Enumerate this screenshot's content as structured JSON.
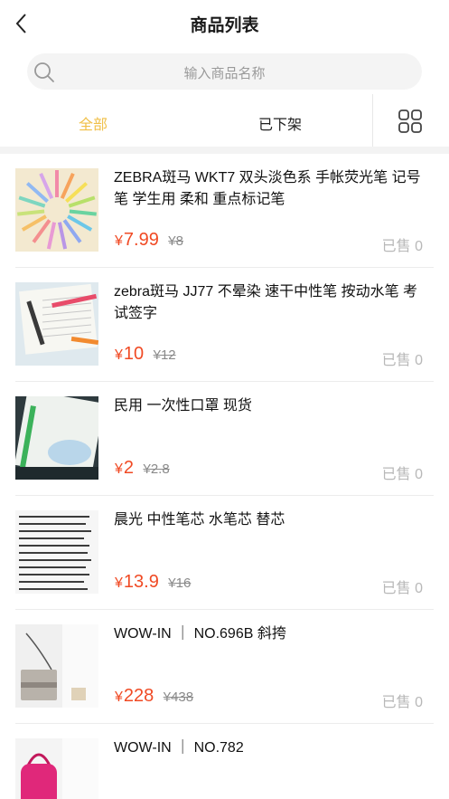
{
  "header": {
    "title": "商品列表",
    "back_icon": "chevron-left-icon"
  },
  "search": {
    "placeholder": "输入商品名称",
    "icon": "search-icon"
  },
  "tabs": [
    {
      "label": "全部",
      "active": true
    },
    {
      "label": "已下架",
      "active": false
    }
  ],
  "view_toggle_icon": "grid-view-icon",
  "colors": {
    "accent": "#f0c04a",
    "price": "#f04a24",
    "muted": "#b8b8b8"
  },
  "products": [
    {
      "name": "ZEBRA斑马 WKT7 双头淡色系 手帐荧光笔 记号笔 学生用 柔和 重点标记笔",
      "currency": "¥",
      "price": "7.99",
      "original_price": "¥8",
      "sold": "已售 0"
    },
    {
      "name": "zebra斑马 JJ77 不晕染 速干中性笔 按动水笔 考试签字",
      "currency": "¥",
      "price": "10",
      "original_price": "¥12",
      "sold": "已售 0"
    },
    {
      "name": "民用 一次性口罩 现货",
      "currency": "¥",
      "price": "2",
      "original_price": "¥2.8",
      "sold": "已售 0"
    },
    {
      "name": "晨光 中性笔芯 水笔芯 替芯",
      "currency": "¥",
      "price": "13.9",
      "original_price": "¥16",
      "sold": "已售 0"
    },
    {
      "name": "WOW-IN ｜ NO.696B 斜挎",
      "currency": "¥",
      "price": "228",
      "original_price": "¥438",
      "sold": "已售 0"
    },
    {
      "name": "WOW-IN ｜ NO.782",
      "currency": "¥",
      "price": "",
      "original_price": "",
      "sold": ""
    }
  ]
}
